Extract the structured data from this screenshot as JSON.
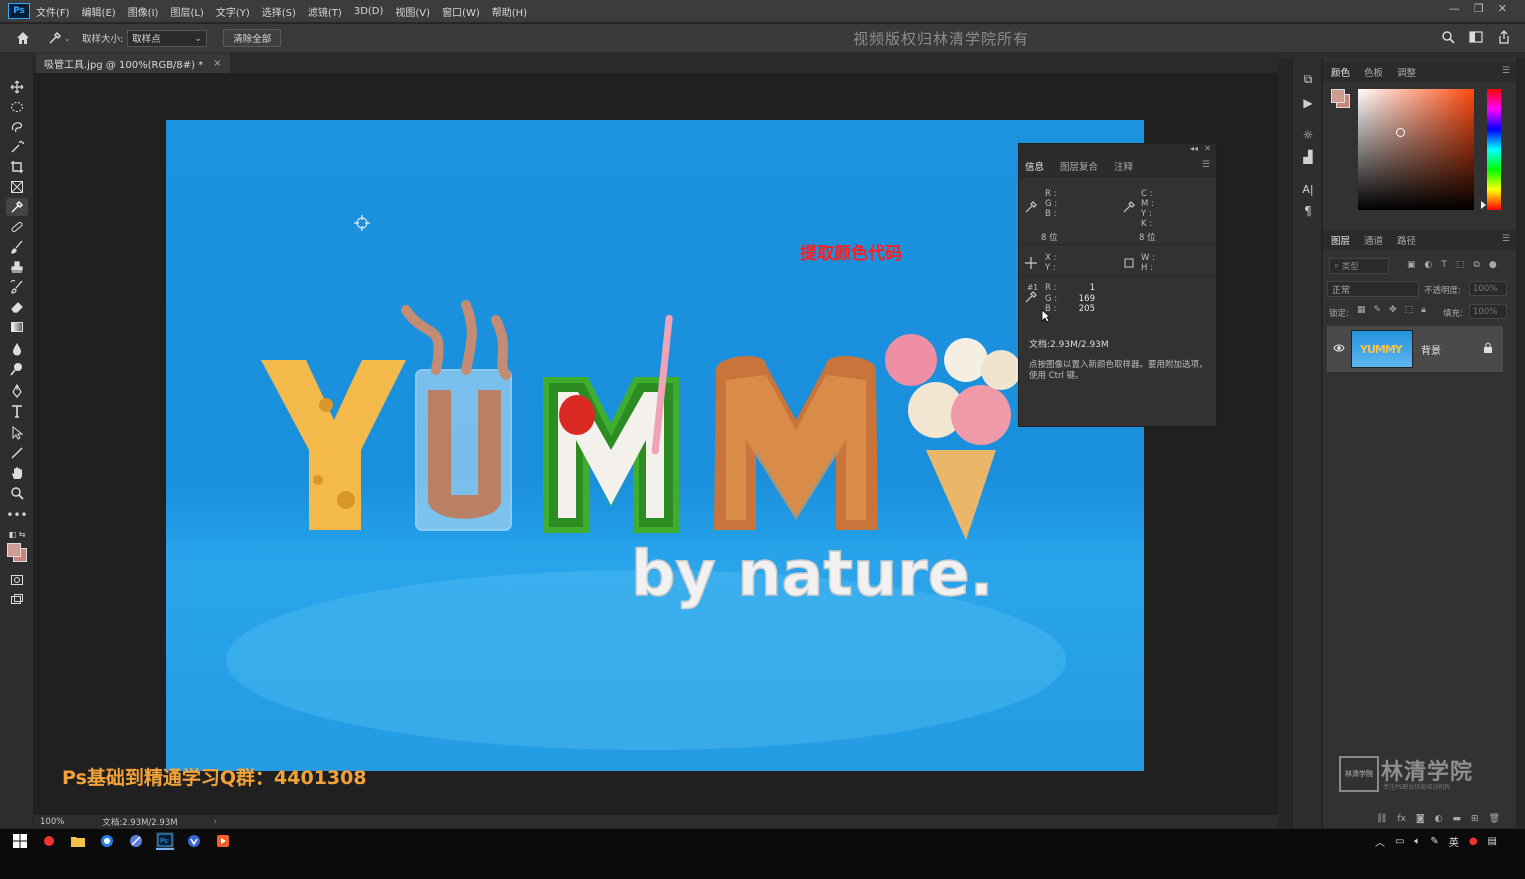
{
  "app": {
    "logo_text": "Ps",
    "menus": [
      "文件(F)",
      "编辑(E)",
      "图像(I)",
      "图层(L)",
      "文字(Y)",
      "选择(S)",
      "滤镜(T)",
      "3D(D)",
      "视图(V)",
      "窗口(W)",
      "帮助(H)"
    ]
  },
  "options_bar": {
    "sample_size_label": "取样大小:",
    "sample_size_value": "取样点",
    "clear_all_label": "清除全部",
    "watermark": "视频版权归林清学院所有"
  },
  "document": {
    "tab_title": "吸管工具.jpg @ 100%(RGB/8#) *",
    "tab_close": "×",
    "extract_label": "提取颜色代码",
    "artwork_text_big": "YUMMY",
    "artwork_text_small": "by nature."
  },
  "overlay": {
    "qq_group": "Ps基础到精通学习Q群：4401308"
  },
  "info_panel": {
    "tabs": [
      "信息",
      "图层复合",
      "注释"
    ],
    "rgb_labels": [
      "R :",
      "G :",
      "B :"
    ],
    "cmyk_labels": [
      "C :",
      "M :",
      "Y :",
      "K :"
    ],
    "bit_left": "8 位",
    "bit_right": "8 位",
    "xy_labels": [
      "X :",
      "Y :"
    ],
    "wh_labels": [
      "W :",
      "H :"
    ],
    "sample_tag": "#1",
    "sample_labels": [
      "R :",
      "G :",
      "B :"
    ],
    "sample_values": [
      "1",
      "169",
      "205"
    ],
    "doc_info": "文档:2.93M/2.93M",
    "hint": "点按图像以置入新颜色取样器。要用附加选项，使用 Ctrl 键。"
  },
  "color_panel": {
    "tabs": [
      "颜色",
      "色板",
      "调整"
    ],
    "foreground": "#cf9c91",
    "background": "#c8867a"
  },
  "layers_panel": {
    "tabs": [
      "图层",
      "通道",
      "路径"
    ],
    "filter_placeholder": "类型",
    "blend_mode": "正常",
    "opacity_label": "不透明度:",
    "opacity_value": "100%",
    "lock_label": "锁定:",
    "fill_label": "填充:",
    "fill_value": "100%",
    "layer_name": "背景",
    "thumb_text": "YUMMY"
  },
  "branding": {
    "seal": "林清学院",
    "name": "林清学院",
    "sub": "专注PS职业技能培训机构"
  },
  "status_bar": {
    "zoom": "100%",
    "doc_size": "文档:2.93M/2.93M",
    "arrow": "›"
  },
  "taskbar": {
    "ime": "英"
  }
}
